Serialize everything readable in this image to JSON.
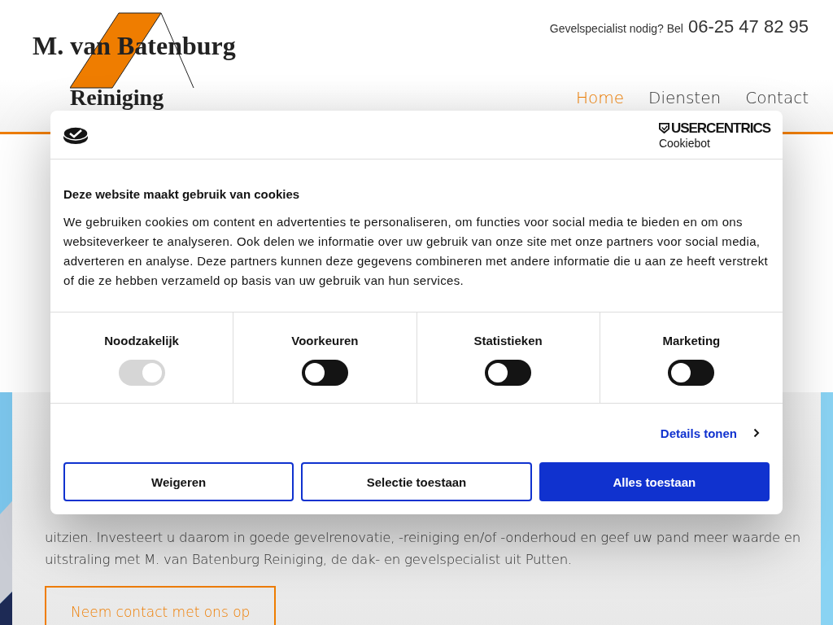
{
  "header": {
    "logo": {
      "name": "M. van Batenburg",
      "subtitle": "Reiniging"
    },
    "contact": {
      "label": "Gevelspecialist nodig? Bel",
      "phone": "06-25 47 82 95"
    },
    "nav": [
      {
        "label": "Home",
        "selected": true
      },
      {
        "label": "Diensten",
        "selected": false
      },
      {
        "label": "Contact",
        "selected": false
      }
    ]
  },
  "content": {
    "lines": [
      "uitzien. Investeert u daarom in goede gevelrenovatie, -reiniging en/of -onderhoud en geef uw pand meer waarde en",
      "uitstraling met M. van Batenburg Reiniging, de dak- en gevelspecialist uit Putten."
    ],
    "button": "Neem contact met ons op"
  },
  "cookie_dialog": {
    "brand": "USERCENTRICS",
    "brand_sub": "Cookiebot",
    "title": "Deze website maakt gebruik van cookies",
    "text": "We gebruiken cookies om content en advertenties te personaliseren, om functies voor social media te bieden en om ons websiteverkeer te analyseren. Ook delen we informatie over uw gebruik van onze site met onze partners voor social media, adverteren en analyse. Deze partners kunnen deze gegevens combineren met andere informatie die u aan ze heeft verstrekt of die ze hebben verzameld op basis van uw gebruik van hun services.",
    "categories": [
      {
        "label": "Noodzakelijk",
        "checked": true,
        "disabled": true
      },
      {
        "label": "Voorkeuren",
        "checked": false,
        "disabled": false
      },
      {
        "label": "Statistieken",
        "checked": false,
        "disabled": false
      },
      {
        "label": "Marketing",
        "checked": false,
        "disabled": false
      }
    ],
    "details_link": "Details tonen",
    "buttons": [
      {
        "label": "Weigeren",
        "kind": "outline"
      },
      {
        "label": "Selectie toestaan",
        "kind": "outline"
      },
      {
        "label": "Alles toestaan",
        "kind": "primary"
      }
    ]
  }
}
